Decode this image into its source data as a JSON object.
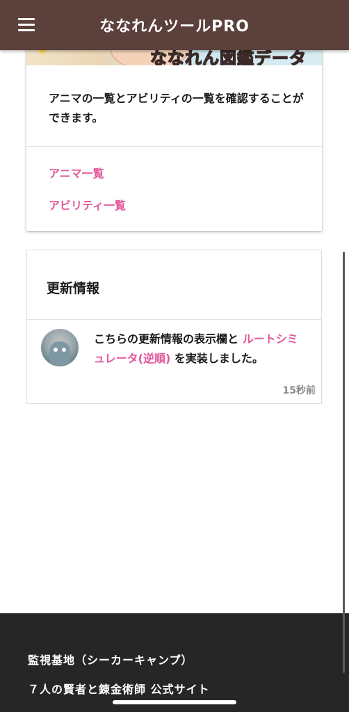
{
  "app": {
    "title": "ななれんツールPRO"
  },
  "header": {
    "menu_icon": "hamburger-menu-icon"
  },
  "card_zukan": {
    "banner_text": "ななれん図鑑データ",
    "description": "アニマの一覧とアビリティの一覧を確認することができます。",
    "links": [
      {
        "label": "アニマ一覧"
      },
      {
        "label": "アビリティ一覧"
      }
    ]
  },
  "card_updates": {
    "title": "更新情報",
    "entries": [
      {
        "text_before": "こちらの更新情報の表示欄と",
        "link": "ルートシミュレータ(逆順)",
        "text_after": "を実装しました。",
        "time": "15秒前"
      }
    ]
  },
  "footer": {
    "links": [
      {
        "label": "監視基地（シーカーキャンプ）"
      },
      {
        "label": "７人の賢者と錬金術師 公式サイト"
      }
    ]
  },
  "colors": {
    "header_bg": "#5b403b",
    "link": "#e2579a",
    "footer_bg": "#262626"
  }
}
